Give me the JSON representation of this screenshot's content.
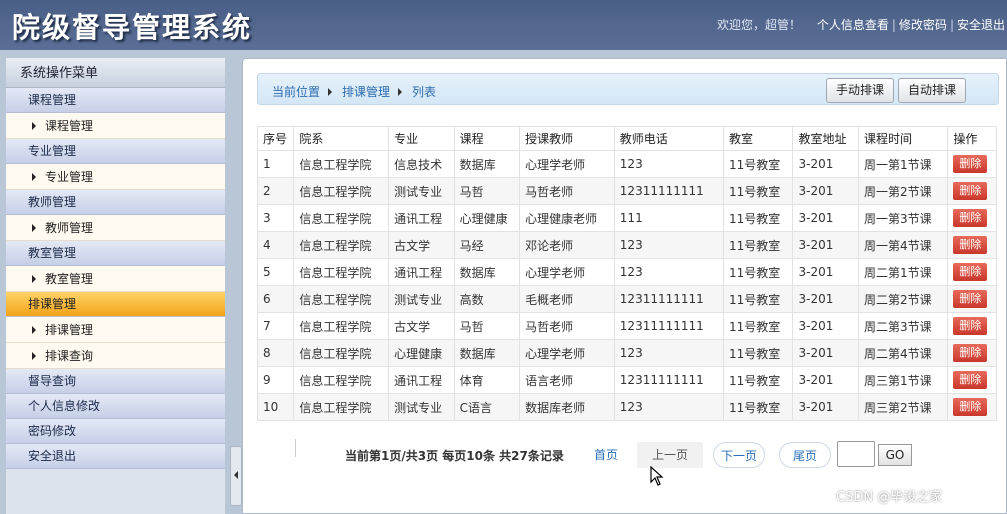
{
  "header": {
    "title": "院级督导管理系统",
    "welcome": "欢迎您，超管！",
    "links": [
      "个人信息查看",
      "修改密码",
      "安全退出"
    ]
  },
  "sidebar": {
    "header": "系统操作菜单",
    "groups": [
      {
        "label": "课程管理",
        "items": [
          "课程管理"
        ]
      },
      {
        "label": "专业管理",
        "items": [
          "专业管理"
        ]
      },
      {
        "label": "教师管理",
        "items": [
          "教师管理"
        ]
      },
      {
        "label": "教室管理",
        "items": [
          "教室管理"
        ]
      },
      {
        "label": "排课管理",
        "active": true,
        "items": [
          "排课管理",
          "排课查询"
        ]
      },
      {
        "label": "督导查询",
        "items": []
      },
      {
        "label": "个人信息修改",
        "items": []
      },
      {
        "label": "密码修改",
        "items": []
      },
      {
        "label": "安全退出",
        "items": []
      }
    ]
  },
  "breadcrumb": [
    "当前位置",
    "排课管理",
    "列表"
  ],
  "toolbar": {
    "manual": "手动排课",
    "auto": "自动排课"
  },
  "table": {
    "columns": [
      "序号",
      "院系",
      "专业",
      "课程",
      "授课教师",
      "教师电话",
      "教室",
      "教室地址",
      "课程时间",
      "操作"
    ],
    "rows": [
      [
        "1",
        "信息工程学院",
        "信息技术",
        "数据库",
        "心理学老师",
        "123",
        "11号教室",
        "3-201",
        "周一第1节课"
      ],
      [
        "2",
        "信息工程学院",
        "测试专业",
        "马哲",
        "马哲老师",
        "12311111111",
        "11号教室",
        "3-201",
        "周一第2节课"
      ],
      [
        "3",
        "信息工程学院",
        "通讯工程",
        "心理健康",
        "心理健康老师",
        "111",
        "11号教室",
        "3-201",
        "周一第3节课"
      ],
      [
        "4",
        "信息工程学院",
        "古文学",
        "马经",
        "邓论老师",
        "123",
        "11号教室",
        "3-201",
        "周一第4节课"
      ],
      [
        "5",
        "信息工程学院",
        "通讯工程",
        "数据库",
        "心理学老师",
        "123",
        "11号教室",
        "3-201",
        "周二第1节课"
      ],
      [
        "6",
        "信息工程学院",
        "测试专业",
        "高数",
        "毛概老师",
        "12311111111",
        "11号教室",
        "3-201",
        "周二第2节课"
      ],
      [
        "7",
        "信息工程学院",
        "古文学",
        "马哲",
        "马哲老师",
        "12311111111",
        "11号教室",
        "3-201",
        "周二第3节课"
      ],
      [
        "8",
        "信息工程学院",
        "心理健康",
        "数据库",
        "心理学老师",
        "123",
        "11号教室",
        "3-201",
        "周二第4节课"
      ],
      [
        "9",
        "信息工程学院",
        "通讯工程",
        "体育",
        "语言老师",
        "12311111111",
        "11号教室",
        "3-201",
        "周三第1节课"
      ],
      [
        "10",
        "信息工程学院",
        "测试专业",
        "C语言",
        "数据库老师",
        "123",
        "11号教室",
        "3-201",
        "周三第2节课"
      ]
    ],
    "delete_label": "删除"
  },
  "pager": {
    "info": "当前第1页/共3页  每页10条  共27条记录",
    "first": "首页",
    "prev": "上一页",
    "next": "下一页",
    "last": "尾页",
    "page_input": "",
    "go": "GO"
  },
  "watermark": "CSDN @毕设之家"
}
